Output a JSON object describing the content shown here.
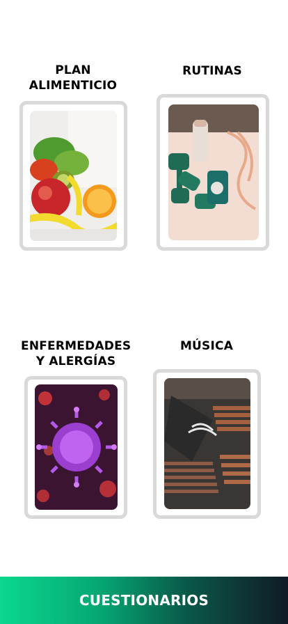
{
  "cards": [
    {
      "title_line1": "PLAN",
      "title_line2": "ALIMENTICIO",
      "image": "fruit-and-measuring-tape-photo"
    },
    {
      "title_line1": "RUTINAS",
      "title_line2": "",
      "image": "dumbbells-phone-bottle-photo"
    },
    {
      "title_line1": "ENFERMEDADES",
      "title_line2": "Y ALERGÍAS",
      "image": "virus-photo"
    },
    {
      "title_line1": "MÚSICA",
      "title_line2": "",
      "image": "vinyl-records-photo"
    }
  ],
  "bottom_bar": {
    "label": "CUESTIONARIOS"
  },
  "colors": {
    "card_border": "#d9d9d9",
    "bar_start": "#0bd88e",
    "bar_end": "#101a26",
    "bar_text": "#ffffff"
  }
}
